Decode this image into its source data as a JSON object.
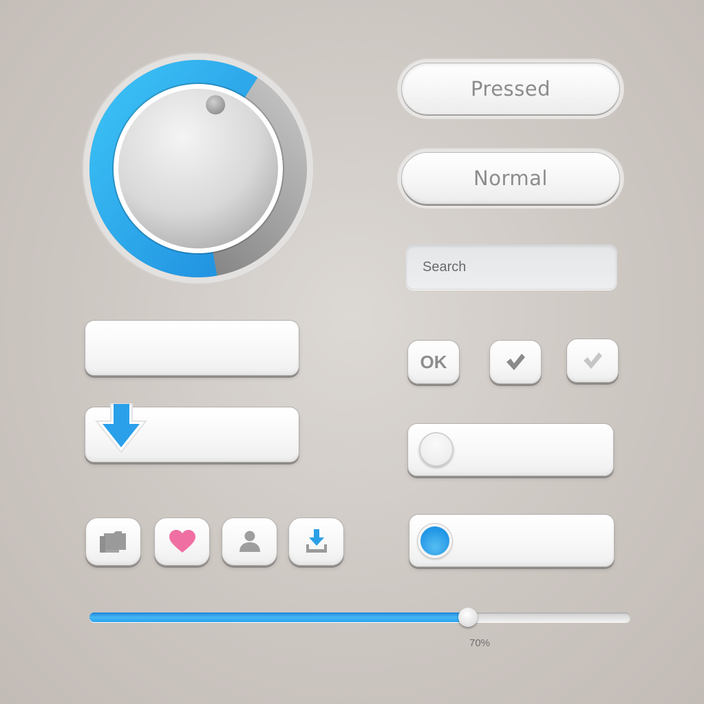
{
  "knob": {
    "value_fraction": 0.62,
    "accent_color": "#29a8ec",
    "track_color": "#9a9a9a"
  },
  "buttons": {
    "pressed_label": "Pressed",
    "normal_label": "Normal",
    "ok_label": "OK"
  },
  "search": {
    "placeholder": "Search",
    "value": ""
  },
  "checkboxes": [
    {
      "state": "checked",
      "check_color": "#8a8a8a"
    },
    {
      "state": "checked-disabled",
      "check_color": "#c6c6c6"
    }
  ],
  "toggles": [
    {
      "state": "off"
    },
    {
      "state": "on",
      "color": "#2196e6"
    }
  ],
  "icon_buttons": [
    {
      "icon": "folder-icon",
      "color": "#9a9a9a"
    },
    {
      "icon": "heart-icon",
      "color": "#f06fa3"
    },
    {
      "icon": "user-icon",
      "color": "#9a9a9a"
    },
    {
      "icon": "download-icon",
      "color": "#2b9fe8"
    }
  ],
  "download_field": {
    "icon": "arrow-down-icon",
    "color": "#2aa0ea"
  },
  "slider": {
    "value_percent": 70,
    "label": "70%",
    "fill_color": "#2ea4ee"
  }
}
